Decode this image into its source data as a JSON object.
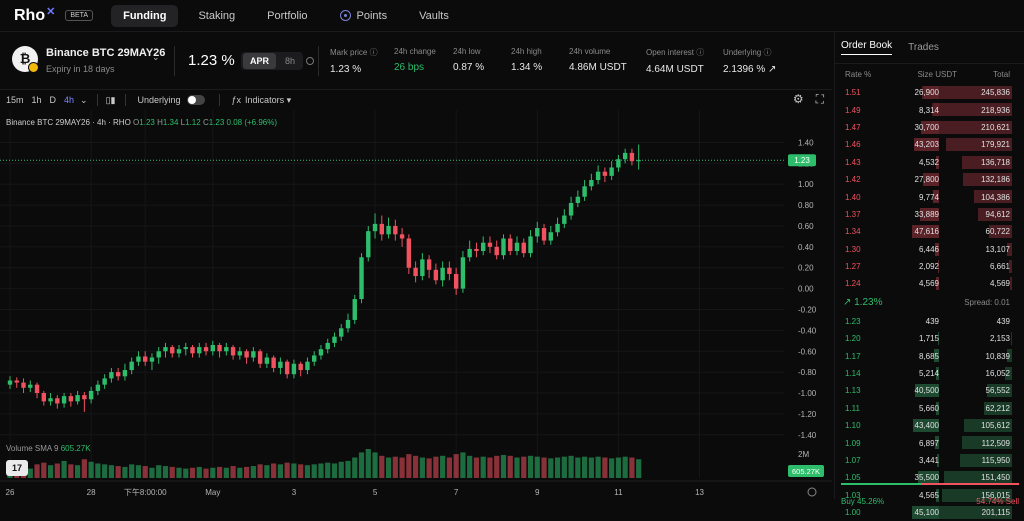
{
  "nav": {
    "logo": "Rho",
    "logo_mark": "✕",
    "beta": "BETA",
    "items": [
      {
        "label": "Funding",
        "active": true
      },
      {
        "label": "Staking"
      },
      {
        "label": "Portfolio"
      },
      {
        "label": "Points"
      },
      {
        "label": "Vaults"
      }
    ]
  },
  "market": {
    "name": "Binance BTC 29MAY26",
    "expiry": "Expiry in 18 days",
    "rate": "1.23 %",
    "apr": "APR",
    "period": "8h",
    "stats": [
      {
        "key": "Mark price ⓘ",
        "value": "1.23 %"
      },
      {
        "key": "24h change",
        "value": "26 bps",
        "green": true
      },
      {
        "key": "24h low",
        "value": "0.87 %"
      },
      {
        "key": "24h high",
        "value": "1.34 %"
      },
      {
        "key": "24h volume",
        "value": "4.86M USDT"
      },
      {
        "key": "Open interest ⓘ",
        "value": "4.64M USDT"
      },
      {
        "key": "Underlying ⓘ",
        "value": "2.1396 % ↗"
      }
    ]
  },
  "toolbar": {
    "intervals": [
      "15m",
      "1h",
      "D",
      "4h"
    ],
    "selected_interval": "4h",
    "chev": "⌄",
    "candle_icon": "🕯",
    "underlying": "Underlying",
    "indicators": "Indicators ▾",
    "fx": "ƒx",
    "gear": "⚙",
    "fullscreen": "⛶"
  },
  "legend": {
    "title": "Binance BTC 29MAY26 · 4h · RHO",
    "o_label": "O",
    "o": "1.23",
    "h_label": "H",
    "h": "1.34",
    "l_label": "L",
    "l": "1.12",
    "c_label": "C",
    "c": "1.23",
    "change": "0.08 (+6.96%)"
  },
  "volume": {
    "label": "Volume SMA 9",
    "value": "605.27K",
    "axis_label": "2M",
    "last_tag": "605.27K"
  },
  "tv_logo": "17",
  "colors": {
    "up": "#2ebd6b",
    "down": "#f0525f",
    "accent": "#7d84ff"
  },
  "chart_data": {
    "type": "candlestick",
    "y_ticks": [
      "1.40",
      "1.20",
      "1.00",
      "0.80",
      "0.60",
      "0.40",
      "0.20",
      "0.00",
      "-0.20",
      "-0.40",
      "-0.60",
      "-0.80",
      "-1.00",
      "-1.20",
      "-1.40"
    ],
    "ylim": [
      -1.45,
      1.5
    ],
    "x_ticks": [
      {
        "label": "26",
        "i": 0
      },
      {
        "label": "28",
        "i": 12
      },
      {
        "label": "下午8:00:00",
        "i": 20
      },
      {
        "label": "May",
        "i": 30
      },
      {
        "label": "3",
        "i": 42
      },
      {
        "label": "5",
        "i": 54
      },
      {
        "label": "7",
        "i": 66
      },
      {
        "label": "9",
        "i": 78
      },
      {
        "label": "11",
        "i": 90
      },
      {
        "label": "13",
        "i": 102
      }
    ],
    "last_price": 1.23,
    "last_price_label": "1.23",
    "candles": [
      [
        -0.92,
        -0.88,
        -0.84,
        -0.96,
        120
      ],
      [
        -0.88,
        -0.9,
        -0.85,
        -0.95,
        90
      ],
      [
        -0.9,
        -0.95,
        -0.86,
        -1.0,
        140
      ],
      [
        -0.95,
        -0.92,
        -0.88,
        -0.99,
        110
      ],
      [
        -0.92,
        -1.0,
        -0.9,
        -1.05,
        160
      ],
      [
        -1.0,
        -1.08,
        -0.98,
        -1.12,
        180
      ],
      [
        -1.08,
        -1.05,
        -1.0,
        -1.12,
        150
      ],
      [
        -1.05,
        -1.1,
        -1.02,
        -1.15,
        170
      ],
      [
        -1.1,
        -1.03,
        -1.0,
        -1.14,
        200
      ],
      [
        -1.03,
        -1.08,
        -1.0,
        -1.13,
        160
      ],
      [
        -1.08,
        -1.02,
        -0.98,
        -1.11,
        150
      ],
      [
        -1.02,
        -1.06,
        -0.99,
        -1.18,
        220
      ],
      [
        -1.06,
        -0.98,
        -0.94,
        -1.1,
        190
      ],
      [
        -0.98,
        -0.92,
        -0.88,
        -1.02,
        170
      ],
      [
        -0.92,
        -0.86,
        -0.82,
        -0.96,
        160
      ],
      [
        -0.86,
        -0.8,
        -0.76,
        -0.9,
        150
      ],
      [
        -0.8,
        -0.84,
        -0.76,
        -0.88,
        140
      ],
      [
        -0.84,
        -0.78,
        -0.72,
        -0.88,
        130
      ],
      [
        -0.78,
        -0.7,
        -0.66,
        -0.82,
        160
      ],
      [
        -0.7,
        -0.65,
        -0.6,
        -0.74,
        150
      ],
      [
        -0.65,
        -0.7,
        -0.6,
        -0.74,
        140
      ],
      [
        -0.7,
        -0.66,
        -0.62,
        -0.78,
        120
      ],
      [
        -0.66,
        -0.6,
        -0.56,
        -0.72,
        150
      ],
      [
        -0.6,
        -0.56,
        -0.52,
        -0.66,
        140
      ],
      [
        -0.56,
        -0.62,
        -0.54,
        -0.66,
        130
      ],
      [
        -0.62,
        -0.58,
        -0.54,
        -0.66,
        120
      ],
      [
        -0.58,
        -0.56,
        -0.52,
        -0.64,
        110
      ],
      [
        -0.56,
        -0.62,
        -0.54,
        -0.66,
        120
      ],
      [
        -0.62,
        -0.56,
        -0.52,
        -0.66,
        130
      ],
      [
        -0.56,
        -0.6,
        -0.52,
        -0.64,
        110
      ],
      [
        -0.6,
        -0.54,
        -0.5,
        -0.64,
        120
      ],
      [
        -0.54,
        -0.6,
        -0.52,
        -0.66,
        130
      ],
      [
        -0.6,
        -0.56,
        -0.52,
        -0.64,
        120
      ],
      [
        -0.56,
        -0.64,
        -0.54,
        -0.68,
        140
      ],
      [
        -0.64,
        -0.6,
        -0.56,
        -0.68,
        120
      ],
      [
        -0.6,
        -0.66,
        -0.58,
        -0.72,
        130
      ],
      [
        -0.66,
        -0.6,
        -0.56,
        -0.7,
        140
      ],
      [
        -0.6,
        -0.72,
        -0.58,
        -0.76,
        160
      ],
      [
        -0.72,
        -0.66,
        -0.62,
        -0.76,
        150
      ],
      [
        -0.66,
        -0.76,
        -0.64,
        -0.8,
        170
      ],
      [
        -0.76,
        -0.7,
        -0.66,
        -0.82,
        160
      ],
      [
        -0.7,
        -0.82,
        -0.68,
        -0.86,
        180
      ],
      [
        -0.82,
        -0.72,
        -0.68,
        -0.86,
        170
      ],
      [
        -0.72,
        -0.78,
        -0.7,
        -0.84,
        160
      ],
      [
        -0.78,
        -0.7,
        -0.66,
        -0.82,
        150
      ],
      [
        -0.7,
        -0.64,
        -0.6,
        -0.74,
        160
      ],
      [
        -0.64,
        -0.58,
        -0.54,
        -0.68,
        170
      ],
      [
        -0.58,
        -0.52,
        -0.48,
        -0.62,
        180
      ],
      [
        -0.52,
        -0.46,
        -0.42,
        -0.56,
        170
      ],
      [
        -0.46,
        -0.38,
        -0.34,
        -0.5,
        190
      ],
      [
        -0.38,
        -0.3,
        -0.24,
        -0.42,
        200
      ],
      [
        -0.3,
        -0.1,
        -0.06,
        -0.34,
        240
      ],
      [
        -0.1,
        0.3,
        0.34,
        -0.14,
        300
      ],
      [
        0.3,
        0.55,
        0.6,
        0.26,
        340
      ],
      [
        0.55,
        0.62,
        0.72,
        0.48,
        300
      ],
      [
        0.62,
        0.52,
        0.7,
        0.46,
        260
      ],
      [
        0.52,
        0.6,
        0.68,
        0.48,
        240
      ],
      [
        0.6,
        0.52,
        0.66,
        0.46,
        250
      ],
      [
        0.52,
        0.48,
        0.58,
        0.4,
        240
      ],
      [
        0.48,
        0.2,
        0.52,
        0.14,
        280
      ],
      [
        0.2,
        0.12,
        0.26,
        0.06,
        260
      ],
      [
        0.12,
        0.28,
        0.34,
        0.08,
        240
      ],
      [
        0.28,
        0.18,
        0.32,
        0.1,
        230
      ],
      [
        0.18,
        0.08,
        0.24,
        0.04,
        250
      ],
      [
        0.08,
        0.2,
        0.26,
        0.02,
        260
      ],
      [
        0.2,
        0.14,
        0.26,
        0.08,
        240
      ],
      [
        0.14,
        0.0,
        0.2,
        -0.06,
        280
      ],
      [
        0.0,
        0.3,
        0.36,
        -0.04,
        300
      ],
      [
        0.3,
        0.38,
        0.46,
        0.26,
        260
      ],
      [
        0.38,
        0.36,
        0.44,
        0.3,
        240
      ],
      [
        0.36,
        0.44,
        0.5,
        0.32,
        250
      ],
      [
        0.44,
        0.4,
        0.5,
        0.34,
        240
      ],
      [
        0.4,
        0.32,
        0.46,
        0.28,
        260
      ],
      [
        0.32,
        0.48,
        0.52,
        0.28,
        270
      ],
      [
        0.48,
        0.36,
        0.52,
        0.32,
        260
      ],
      [
        0.36,
        0.44,
        0.5,
        0.32,
        240
      ],
      [
        0.44,
        0.34,
        0.48,
        0.3,
        250
      ],
      [
        0.34,
        0.5,
        0.56,
        0.3,
        260
      ],
      [
        0.5,
        0.58,
        0.64,
        0.44,
        250
      ],
      [
        0.58,
        0.46,
        0.62,
        0.42,
        240
      ],
      [
        0.46,
        0.54,
        0.6,
        0.42,
        230
      ],
      [
        0.54,
        0.62,
        0.68,
        0.5,
        240
      ],
      [
        0.62,
        0.7,
        0.76,
        0.58,
        250
      ],
      [
        0.7,
        0.82,
        0.88,
        0.66,
        260
      ],
      [
        0.82,
        0.88,
        0.94,
        0.78,
        240
      ],
      [
        0.88,
        0.98,
        1.04,
        0.84,
        250
      ],
      [
        0.98,
        1.04,
        1.1,
        0.94,
        240
      ],
      [
        1.04,
        1.12,
        1.18,
        1.0,
        250
      ],
      [
        1.12,
        1.08,
        1.16,
        1.02,
        240
      ],
      [
        1.08,
        1.16,
        1.22,
        1.04,
        230
      ],
      [
        1.16,
        1.24,
        1.28,
        1.12,
        240
      ],
      [
        1.24,
        1.3,
        1.34,
        1.2,
        250
      ],
      [
        1.3,
        1.22,
        1.34,
        1.18,
        240
      ],
      [
        1.22,
        1.23,
        1.38,
        1.14,
        220
      ]
    ]
  },
  "orderbook": {
    "tabs": [
      "Order Book",
      "Trades"
    ],
    "headers": [
      "Rate %",
      "Size USDT",
      "Total"
    ],
    "asks": [
      {
        "p": "1.51",
        "s": "26,900",
        "t": "245,836",
        "frac": 1.0,
        "sfrac": 0.45
      },
      {
        "p": "1.49",
        "s": "8,314",
        "t": "218,936",
        "frac": 0.89,
        "sfrac": 0.14
      },
      {
        "p": "1.47",
        "s": "30,700",
        "t": "210,621",
        "frac": 0.86,
        "sfrac": 0.52
      },
      {
        "p": "1.46",
        "s": "43,203",
        "t": "179,921",
        "frac": 0.73,
        "sfrac": 0.73
      },
      {
        "p": "1.43",
        "s": "4,532",
        "t": "136,718",
        "frac": 0.56,
        "sfrac": 0.08
      },
      {
        "p": "1.42",
        "s": "27,800",
        "t": "132,186",
        "frac": 0.54,
        "sfrac": 0.47
      },
      {
        "p": "1.40",
        "s": "9,774",
        "t": "104,386",
        "frac": 0.42,
        "sfrac": 0.17
      },
      {
        "p": "1.37",
        "s": "33,889",
        "t": "94,612",
        "frac": 0.38,
        "sfrac": 0.57
      },
      {
        "p": "1.34",
        "s": "47,616",
        "t": "60,722",
        "frac": 0.25,
        "sfrac": 0.8
      },
      {
        "p": "1.30",
        "s": "6,446",
        "t": "13,107",
        "frac": 0.05,
        "sfrac": 0.11
      },
      {
        "p": "1.27",
        "s": "2,092",
        "t": "6,661",
        "frac": 0.03,
        "sfrac": 0.04
      },
      {
        "p": "1.24",
        "s": "4,569",
        "t": "4,569",
        "frac": 0.02,
        "sfrac": 0.08
      }
    ],
    "mid": {
      "rate": "↗ 1.23%",
      "spread": "Spread: 0.01"
    },
    "bids": [
      {
        "p": "1.23",
        "s": "439",
        "t": "439",
        "frac": 0.0,
        "sfrac": 0.01
      },
      {
        "p": "1.20",
        "s": "1,715",
        "t": "2,153",
        "frac": 0.01,
        "sfrac": 0.03
      },
      {
        "p": "1.17",
        "s": "8,685",
        "t": "10,839",
        "frac": 0.05,
        "sfrac": 0.15
      },
      {
        "p": "1.14",
        "s": "5,214",
        "t": "16,052",
        "frac": 0.08,
        "sfrac": 0.09
      },
      {
        "p": "1.13",
        "s": "40,500",
        "t": "56,552",
        "frac": 0.28,
        "sfrac": 0.7
      },
      {
        "p": "1.11",
        "s": "5,660",
        "t": "62,212",
        "frac": 0.31,
        "sfrac": 0.1
      },
      {
        "p": "1.10",
        "s": "43,400",
        "t": "105,612",
        "frac": 0.53,
        "sfrac": 0.75
      },
      {
        "p": "1.09",
        "s": "6,897",
        "t": "112,509",
        "frac": 0.56,
        "sfrac": 0.12
      },
      {
        "p": "1.07",
        "s": "3,441",
        "t": "115,950",
        "frac": 0.58,
        "sfrac": 0.06
      },
      {
        "p": "1.05",
        "s": "35,500",
        "t": "151,450",
        "frac": 0.75,
        "sfrac": 0.61
      },
      {
        "p": "1.03",
        "s": "4,565",
        "t": "156,015",
        "frac": 0.78,
        "sfrac": 0.08
      },
      {
        "p": "1.00",
        "s": "45,100",
        "t": "201,115",
        "frac": 1.0,
        "sfrac": 0.78
      }
    ],
    "buy": "Buy 45.26%",
    "sell": "54.74% Sell",
    "buy_frac": 0.4526
  }
}
